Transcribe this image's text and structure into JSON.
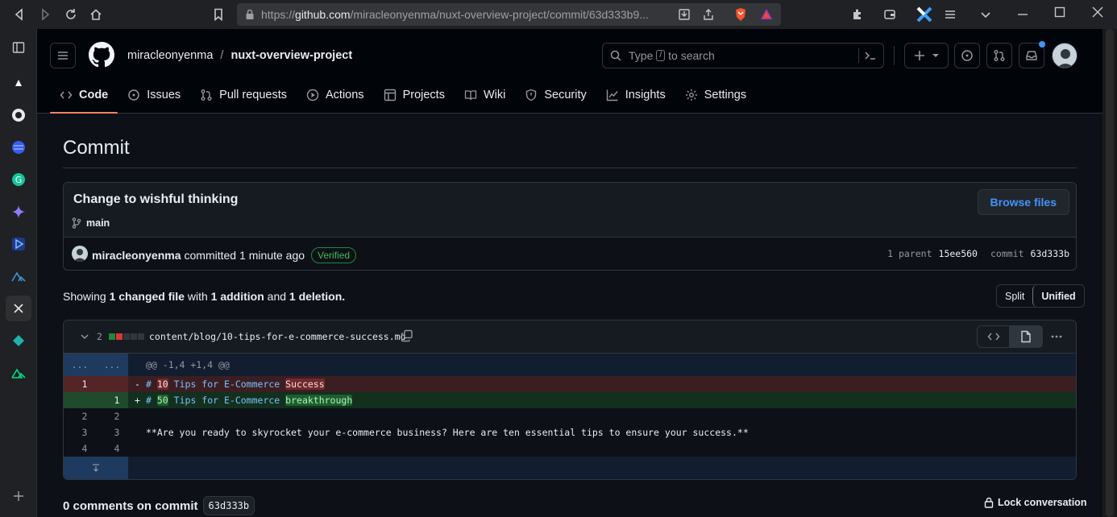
{
  "browser": {
    "url_prefix": "https://",
    "url_host": "github.com",
    "url_path": "/miracleonyenma/nuxt-overview-project/commit/63d333b9..."
  },
  "repo": {
    "owner": "miracleonyenma",
    "separator": "/",
    "name": "nuxt-overview-project"
  },
  "search": {
    "placeholder_start": "Type",
    "slash_key": "/",
    "placeholder_end": "to search"
  },
  "nav": [
    {
      "label": "Code",
      "icon": "code-icon",
      "active": true
    },
    {
      "label": "Issues",
      "icon": "issue-icon"
    },
    {
      "label": "Pull requests",
      "icon": "pull-request-icon"
    },
    {
      "label": "Actions",
      "icon": "play-icon"
    },
    {
      "label": "Projects",
      "icon": "table-icon"
    },
    {
      "label": "Wiki",
      "icon": "book-icon"
    },
    {
      "label": "Security",
      "icon": "shield-icon"
    },
    {
      "label": "Insights",
      "icon": "graph-icon"
    },
    {
      "label": "Settings",
      "icon": "gear-icon"
    }
  ],
  "page_title": "Commit",
  "commit": {
    "message": "Change to wishful thinking",
    "branch": "main",
    "browse_label": "Browse files",
    "author": "miracleonyenma",
    "action": "committed",
    "time": "1 minute ago",
    "verified": "Verified",
    "parent_label": "1 parent",
    "parent_sha": "15ee560",
    "commit_label": "commit",
    "sha": "63d333b"
  },
  "summary": {
    "showing": "Showing",
    "files": "1 changed file",
    "with": "with",
    "additions": "1 addition",
    "and": "and",
    "deletions": "1 deletion",
    "end": "."
  },
  "view_toggle": {
    "split": "Split",
    "unified": "Unified",
    "selected": "Unified"
  },
  "file": {
    "changes": "2",
    "path": "content/blog/10-tips-for-e-commerce-success.md",
    "hunk_placeholder": "...",
    "hunk": "@@ -1,4 +1,4 @@",
    "lines": [
      {
        "type": "del",
        "old": "1",
        "new": "",
        "sign": "-",
        "hash": "#",
        "num": "10",
        "mid": "Tips for E-Commerce",
        "word": "Success"
      },
      {
        "type": "add",
        "old": "",
        "new": "1",
        "sign": "+",
        "hash": "#",
        "num": "50",
        "mid": "Tips for E-Commerce",
        "word": "breakthrough"
      },
      {
        "type": "ctx",
        "old": "2",
        "new": "2",
        "text": ""
      },
      {
        "type": "ctx",
        "old": "3",
        "new": "3",
        "text": "**Are you ready to skyrocket your e-commerce business? Here are ten essential tips to ensure your success.**"
      },
      {
        "type": "ctx",
        "old": "4",
        "new": "4",
        "text": ""
      }
    ]
  },
  "comments": {
    "label": "0 comments on commit",
    "sha": "63d333b",
    "lock": "Lock conversation"
  },
  "colors": {
    "accent": "#4493f8",
    "added": "#3fb950",
    "deleted": "#f85149",
    "tab_underline": "#f78166"
  }
}
